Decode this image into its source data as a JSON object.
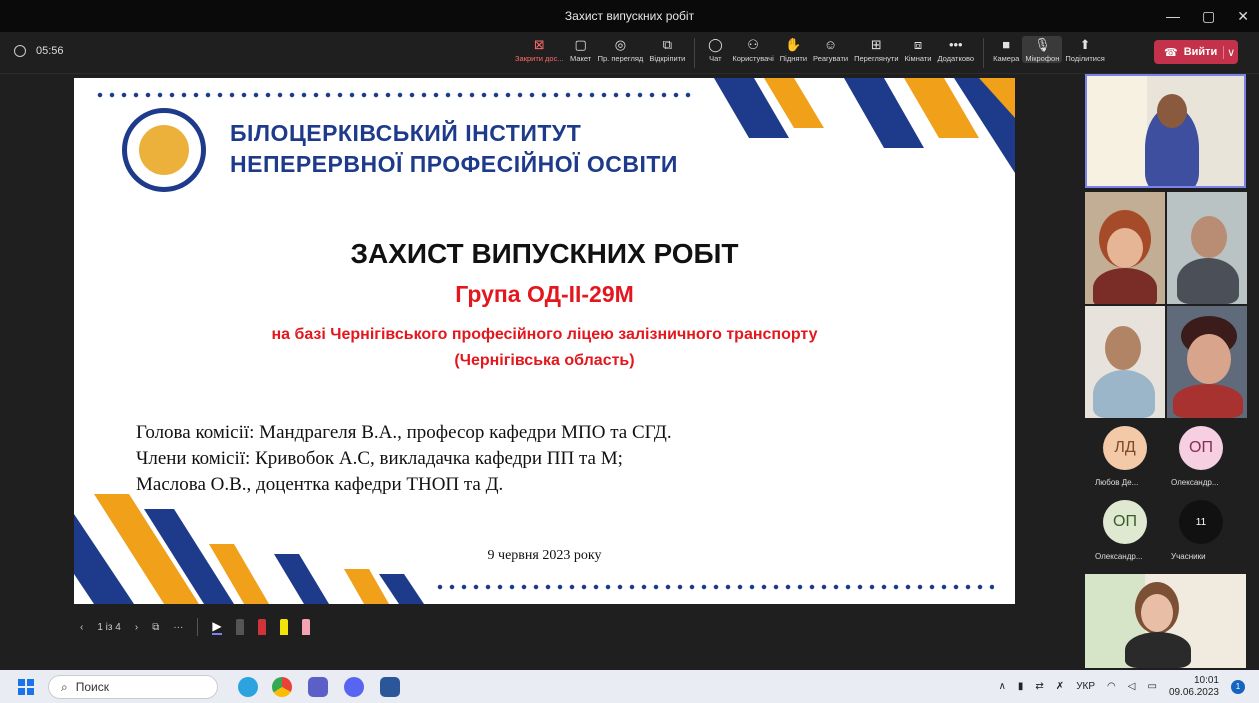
{
  "window": {
    "title": "Захист випускних робіт",
    "minimize": "—",
    "maximize": "▢",
    "close": "✕"
  },
  "meeting": {
    "timer": "05:56"
  },
  "toolbar": [
    {
      "label": "Закрити дос...",
      "icon": "⊠"
    },
    {
      "label": "Макет",
      "icon": "▢"
    },
    {
      "label": "Пр. перегляд",
      "icon": "◎"
    },
    {
      "label": "Відкріпити",
      "icon": "⧉"
    },
    {
      "label": "Чат",
      "icon": "◯"
    },
    {
      "label": "Користувачі",
      "icon": "⚇"
    },
    {
      "label": "Підняти",
      "icon": "✋"
    },
    {
      "label": "Реагувати",
      "icon": "☺"
    },
    {
      "label": "Переглянути",
      "icon": "⊞"
    },
    {
      "label": "Кімнати",
      "icon": "⧈"
    },
    {
      "label": "Додатково",
      "icon": "•••"
    },
    {
      "label": "Камера",
      "icon": "■"
    },
    {
      "label": "Мікрофон",
      "icon": "🎙"
    },
    {
      "label": "Поділитися",
      "icon": "⬆"
    }
  ],
  "leave": {
    "label": "Вийти",
    "icon": "☎",
    "dropdown": "∨"
  },
  "slide": {
    "institute_line1": "БІЛОЦЕРКІВСЬКИЙ ІНСТИТУТ",
    "institute_line2": "НЕПЕРЕРВНОЇ ПРОФЕСІЙНОЇ ОСВІТИ",
    "title": "ЗАХИСТ ВИПУСКНИХ РОБІТ",
    "group": "Група ОД-ІІ-29М",
    "base_line1": "на базі Чернігівського професійного ліцею залізничного транспорту",
    "base_line2": "(Чернігівська область)",
    "commission_head": "Голова комісії: Мандрагеля В.А., професор кафедри МПО та СГД.",
    "commission_members": "Члени комісії: Кривобок А.С, викладачка кафедри ПП та М;",
    "commission_member2": "Маслова О.В., доцентка кафедри ТНОП та Д.",
    "date": "9 червня 2023 року"
  },
  "slide_nav": {
    "prev": "‹",
    "page": "1 із 4",
    "next": "›",
    "grid": "⧉",
    "more": "···"
  },
  "participants": [
    {
      "initials": "ЛД",
      "name": "Любов Де...",
      "color": "#f4c9a8",
      "text": "#7a4a2a"
    },
    {
      "initials": "ОП",
      "name": "Олександр...",
      "color": "#f6cfe0",
      "text": "#8a2a55"
    },
    {
      "initials": "ОП",
      "name": "Олександр...",
      "color": "#dfe8d0",
      "text": "#3a5a2a"
    },
    {
      "initials": "11",
      "name": "Учасники",
      "color": "#111111",
      "text": "#ffffff"
    }
  ],
  "taskbar": {
    "search": "Поиск",
    "lang": "УКР",
    "time": "10:01",
    "date": "09.06.2023",
    "notif": "1"
  }
}
